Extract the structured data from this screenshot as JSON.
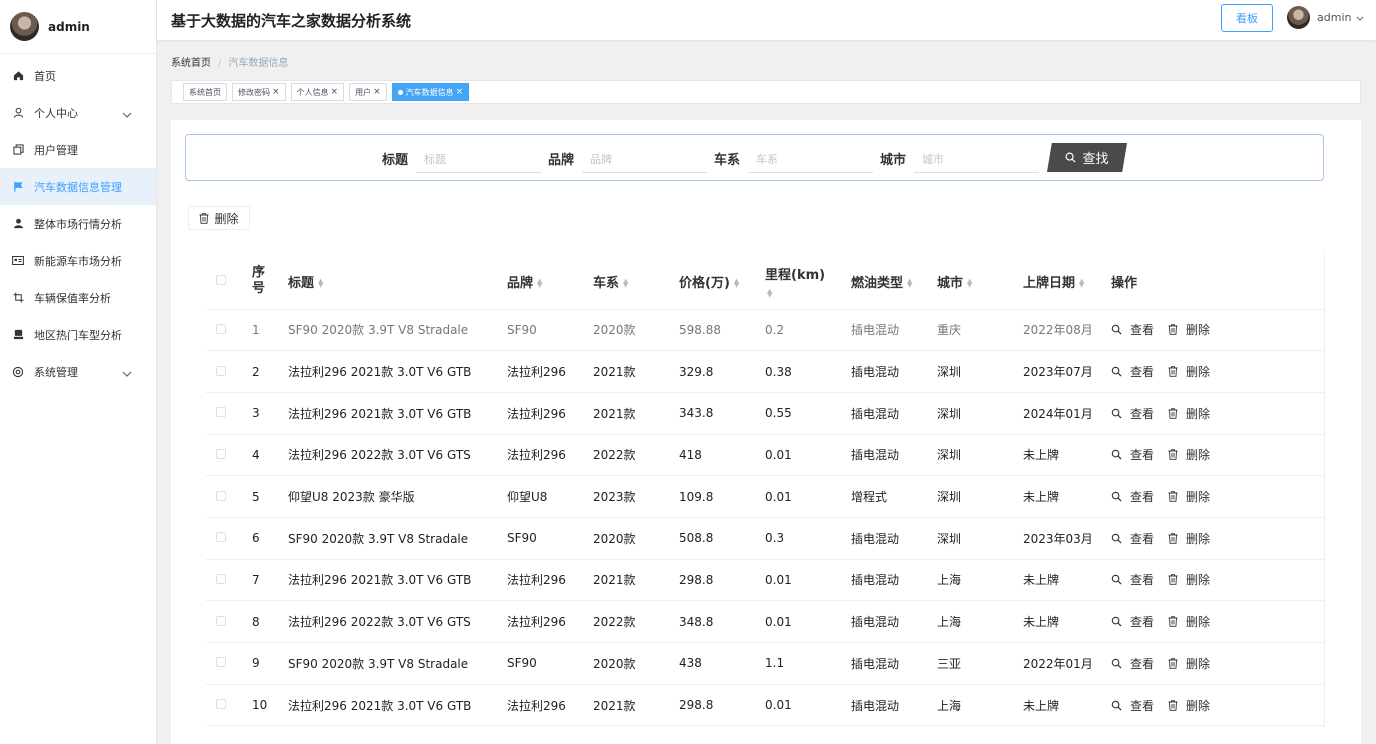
{
  "sidebar": {
    "user": "admin",
    "items": [
      {
        "label": "首页",
        "icon": "home-icon"
      },
      {
        "label": "个人中心",
        "icon": "user-icon",
        "expandable": true
      },
      {
        "label": "用户管理",
        "icon": "copy-icon"
      },
      {
        "label": "汽车数据信息管理",
        "icon": "flag-icon",
        "active": true
      },
      {
        "label": "整体市场行情分析",
        "icon": "person-icon"
      },
      {
        "label": "新能源车市场分析",
        "icon": "card-icon"
      },
      {
        "label": "车辆保值率分析",
        "icon": "crop-icon"
      },
      {
        "label": "地区热门车型分析",
        "icon": "stamp-icon"
      },
      {
        "label": "系统管理",
        "icon": "gear-icon",
        "expandable": true
      }
    ]
  },
  "header": {
    "title": "基于大数据的汽车之家数据分析系统",
    "board_button": "看板",
    "user": "admin"
  },
  "breadcrumb": {
    "home": "系统首页",
    "sep": "/",
    "current": "汽车数据信息"
  },
  "tags": [
    {
      "label": "系统首页",
      "closable": false
    },
    {
      "label": "修改密码",
      "closable": true
    },
    {
      "label": "个人信息",
      "closable": true
    },
    {
      "label": "用户",
      "closable": true
    },
    {
      "label": "汽车数据信息",
      "closable": true,
      "active": true
    }
  ],
  "search": {
    "fields": [
      {
        "label": "标题",
        "placeholder": "标题"
      },
      {
        "label": "品牌",
        "placeholder": "品牌"
      },
      {
        "label": "车系",
        "placeholder": "车系"
      },
      {
        "label": "城市",
        "placeholder": "城市"
      }
    ],
    "button": "查找"
  },
  "toolbar": {
    "delete_label": "删除"
  },
  "table": {
    "columns": [
      "序号",
      "标题",
      "品牌",
      "车系",
      "价格(万)",
      "里程(km)",
      "燃油类型",
      "城市",
      "上牌日期",
      "操作"
    ],
    "view_label": "查看",
    "delete_label": "删除",
    "rows": [
      [
        "1",
        "SF90 2020款 3.9T V8 Stradale",
        "SF90",
        "2020款",
        "598.88",
        "0.2",
        "插电混动",
        "重庆",
        "2022年08月"
      ],
      [
        "2",
        "法拉利296 2021款 3.0T V6 GTB",
        "法拉利296",
        "2021款",
        "329.8",
        "0.38",
        "插电混动",
        "深圳",
        "2023年07月"
      ],
      [
        "3",
        "法拉利296 2021款 3.0T V6 GTB",
        "法拉利296",
        "2021款",
        "343.8",
        "0.55",
        "插电混动",
        "深圳",
        "2024年01月"
      ],
      [
        "4",
        "法拉利296 2022款 3.0T V6 GTS",
        "法拉利296",
        "2022款",
        "418",
        "0.01",
        "插电混动",
        "深圳",
        "未上牌"
      ],
      [
        "5",
        "仰望U8 2023款 豪华版",
        "仰望U8",
        "2023款",
        "109.8",
        "0.01",
        "增程式",
        "深圳",
        "未上牌"
      ],
      [
        "6",
        "SF90 2020款 3.9T V8 Stradale",
        "SF90",
        "2020款",
        "508.8",
        "0.3",
        "插电混动",
        "深圳",
        "2023年03月"
      ],
      [
        "7",
        "法拉利296 2021款 3.0T V6 GTB",
        "法拉利296",
        "2021款",
        "298.8",
        "0.01",
        "插电混动",
        "上海",
        "未上牌"
      ],
      [
        "8",
        "法拉利296 2022款 3.0T V6 GTS",
        "法拉利296",
        "2022款",
        "348.8",
        "0.01",
        "插电混动",
        "上海",
        "未上牌"
      ],
      [
        "9",
        "SF90 2020款 3.9T V8 Stradale",
        "SF90",
        "2020款",
        "438",
        "1.1",
        "插电混动",
        "三亚",
        "2022年01月"
      ],
      [
        "10",
        "法拉利296 2021款 3.0T V6 GTB",
        "法拉利296",
        "2021款",
        "298.8",
        "0.01",
        "插电混动",
        "上海",
        "未上牌"
      ]
    ]
  }
}
